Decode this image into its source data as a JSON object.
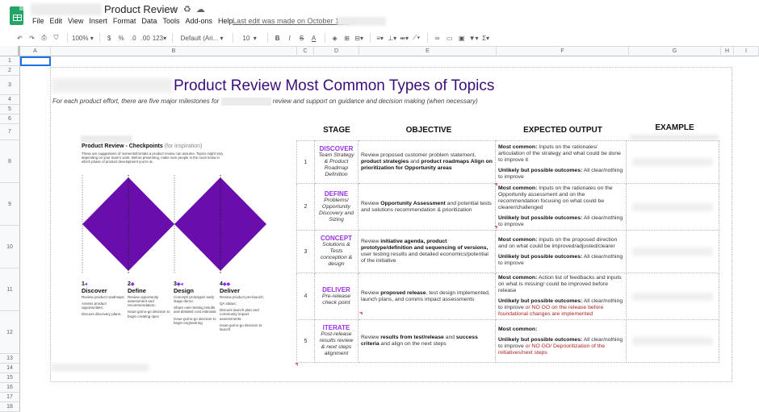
{
  "app": {
    "doc_title": "Product Review",
    "title_icons": [
      "star-icon",
      "move-to-drive-icon",
      "cloud-status-icon"
    ],
    "menus": [
      "File",
      "Edit",
      "View",
      "Insert",
      "Format",
      "Data",
      "Tools",
      "Add-ons",
      "Help"
    ],
    "last_edit": "Last edit was made on October 1 by"
  },
  "toolbar": {
    "zoom": "100%",
    "currency": "$",
    "percent": "%",
    "dec_decrease": ".0",
    "dec_increase": ".00",
    "more_formats": "123",
    "font": "Default (Ari...",
    "font_size": "10",
    "bold": "B",
    "italic": "I",
    "strike": "S",
    "text_color": "A"
  },
  "columns": [
    "A",
    "B",
    "C",
    "D",
    "E",
    "F",
    "G",
    "H",
    "I"
  ],
  "rows": [
    "1",
    "2",
    "3",
    "4",
    "5",
    "6",
    "7",
    "8",
    "9",
    "10",
    "11",
    "12",
    "13",
    "14",
    "15",
    "16",
    "17",
    "18"
  ],
  "sheet": {
    "title": "Product Review Most Common Types of Topics",
    "subtitle_before": "For each product effort, there are five major milestones for",
    "subtitle_after": "review and support on guidance and decision making (when necessary)",
    "checkpoints": {
      "title": "Product Review - Checkpoints",
      "title_note": "(for inspiration)",
      "description": "These are suggestions of moments/formats a product review can assume. Topics might vary depending on your team's work. Before presenting, make sure people in the room know in which phase of product development you're at.",
      "diagram_color": "#6a0dad",
      "phases": [
        {
          "num": "1",
          "arrow": "◂",
          "name": "Discover",
          "items": [
            "Review product roadmaps;",
            "Assess product opportunities;",
            "Discuss discovery plans."
          ]
        },
        {
          "num": "2",
          "arrow": "◆",
          "name": "Define",
          "items": [
            "Review opportunity assessment and recommendation;",
            "Issue go/no-go decision to begin creating spec"
          ]
        },
        {
          "num": "3",
          "arrow": "◆◂",
          "name": "Design",
          "items": [
            "Concept/ prototype/ early stage demo;",
            "Share user-testing results and detailed cost estimate;",
            "Issue go/no-go decision to begin engineering"
          ]
        },
        {
          "num": "4",
          "arrow": "◆◆",
          "name": "Deliver",
          "items": [
            "Review product pre-launch;",
            "QA status;",
            "Discuss launch plan and community impact assessments;",
            "Issue go/no-go decision to launch"
          ]
        }
      ]
    },
    "table": {
      "headers": {
        "stage": "STAGE",
        "objective": "OBJECTIVE",
        "output": "EXPECTED OUTPUT",
        "example": "EXAMPLE"
      },
      "rows": [
        {
          "num": "1",
          "stage": "DISCOVER",
          "stage_desc": "Team Strategy & Product Roadmap Definition",
          "objective": [
            {
              "t": "Review proposed customer problem statement, ",
              "b": false
            },
            {
              "t": "product strategies",
              "b": true
            },
            {
              "t": " and ",
              "b": false
            },
            {
              "t": "product roadmaps",
              "b": true
            },
            {
              "t": " Align on prioritization for Opportunity areas",
              "b": true
            }
          ],
          "common_label": "Most common:",
          "common": "Inputs on the rationales/ articulation of the strategy and what could be done to improve it",
          "unlikely_label": "Unlikely but possible outcomes:",
          "unlikely": "All clear/nothing to improve",
          "unlikely_red": ""
        },
        {
          "num": "2",
          "stage": "DEFINE",
          "stage_desc": "Problems/ Opportunity Discovery and Sizing",
          "objective": [
            {
              "t": "Review ",
              "b": false
            },
            {
              "t": "Opportunity Assessment",
              "b": true
            },
            {
              "t": " and potential tests and solutions recommendation & prioritization",
              "b": false
            }
          ],
          "common_label": "Most common:",
          "common": "Inputs on the rationales on the Opportunity assessment and on the recommendation focusing on what could be clearer/challenged",
          "unlikely_label": "Unlikely but possible outcomes:",
          "unlikely": "All clear/nothing to improve",
          "unlikely_red": ""
        },
        {
          "num": "3",
          "stage": "CONCEPT",
          "stage_desc": "Solutions & Tests conception & design",
          "objective": [
            {
              "t": "Review ",
              "b": false
            },
            {
              "t": "initiative agenda, product prototype/definition and sequencing of versions,",
              "b": true
            },
            {
              "t": " user testing results and detailed economics/potential of the initiative",
              "b": false
            }
          ],
          "common_label": "Most common:",
          "common": "Inputs on the proposed direction and on what could be improved/adjusted/clearer",
          "unlikely_label": "Unlikely but possible outcomes:",
          "unlikely": "All clear/nothing to improve",
          "unlikely_red": ""
        },
        {
          "num": "4",
          "stage": "DELIVER",
          "stage_desc": "Pre-release check point",
          "objective": [
            {
              "t": "Review ",
              "b": false
            },
            {
              "t": "proposed release",
              "b": true
            },
            {
              "t": ", test design implemented, launch plans, and comms impact assessments",
              "b": false
            }
          ],
          "common_label": "Most common:",
          "common": "Action list of feedbacks and inputs on what is missing/ could be improved before release",
          "unlikely_label": "Unlikely but possible outcomes:",
          "unlikely": "All clear/nothing to improve",
          "unlikely_red": "or NO GO on the release before foundational changes are implemented"
        },
        {
          "num": "5",
          "stage": "ITERATE",
          "stage_desc": "Post-release results review & next steps alignment",
          "objective": [
            {
              "t": "Review ",
              "b": false
            },
            {
              "t": "results from test/release",
              "b": true
            },
            {
              "t": " and ",
              "b": false
            },
            {
              "t": "success criteria",
              "b": true
            },
            {
              "t": " and align on the next steps",
              "b": false
            }
          ],
          "common_label": "Most common:",
          "common": "",
          "unlikely_label": "Unlikely but possible outcomes:",
          "unlikely": "All clear/nothing to improve",
          "unlikely_red": "or NO GO/ Deprioritization of the initiatives/next steps"
        }
      ]
    }
  },
  "colors": {
    "title": "#3b0d7a",
    "stage": "#9b30e8",
    "red": "#b22222",
    "sheets_green": "#23a566",
    "selection": "#1a73e8"
  }
}
